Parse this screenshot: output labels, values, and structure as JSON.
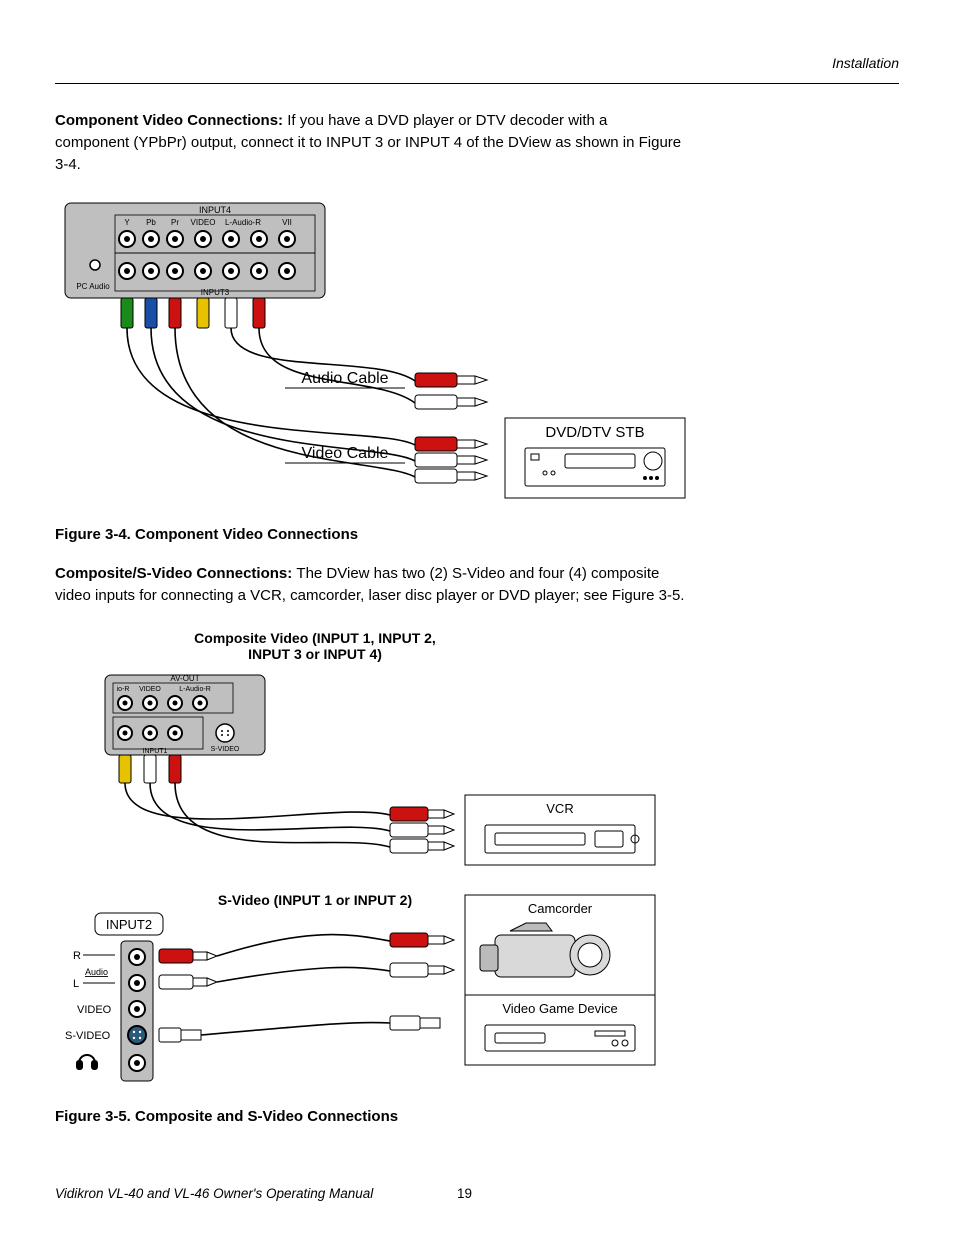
{
  "header": {
    "section": "Installation"
  },
  "para1": {
    "bold": "Component Video Connections: ",
    "l1": "If you have a DVD player or DTV decoder with a",
    "l2": "component (YPbPr) output, connect it to INPUT 3 or INPUT 4 of the DView as shown in Figure",
    "l3": "3-4."
  },
  "fig34": {
    "caption": "Figure 3-4. Component Video Connections",
    "panel": {
      "input4_title": "INPUT4",
      "input3_title": "INPUT3",
      "col_Y": "Y",
      "col_Pb": "Pb",
      "col_Pr": "Pr",
      "col_VIDEO": "VIDEO",
      "col_Laudio": "L-Audio-R",
      "col_VII": "VII",
      "pc_audio": "PC Audio"
    },
    "labels": {
      "audio_cable": "Audio Cable",
      "video_cable": "Video Cable",
      "stb": "DVD/DTV STB"
    }
  },
  "para2": {
    "bold": "Composite/S-Video Connections: ",
    "l1": "The DView has two (2) S-Video and four (4) composite",
    "l2": "video inputs for connecting a VCR, camcorder, laser disc player or DVD player; see Figure 3-5."
  },
  "fig35": {
    "caption": "Figure 3-5. Composite and S-Video Connections",
    "title_l1": "Composite Video (INPUT 1, INPUT 2,",
    "title_l2": "INPUT 3 or INPUT 4)",
    "panel": {
      "avout": "AV-OUT",
      "ioR": "io-R",
      "video": "VIDEO",
      "laudio": "L-Audio-R",
      "svideo": "S-VIDEO",
      "input1": "INPUT1"
    },
    "svideo_title": "S-Video (INPUT 1 or INPUT 2)",
    "input2_box": "INPUT2",
    "left_labels": {
      "R": "R",
      "Audio": "Audio",
      "L": "L",
      "VIDEO": "VIDEO",
      "SVIDEO": "S-VIDEO"
    },
    "devices": {
      "vcr": "VCR",
      "camcorder": "Camcorder",
      "game": "Video Game Device"
    }
  },
  "footer": {
    "text": "Vidikron VL-40 and VL-46 Owner's Operating Manual",
    "page": "19"
  }
}
